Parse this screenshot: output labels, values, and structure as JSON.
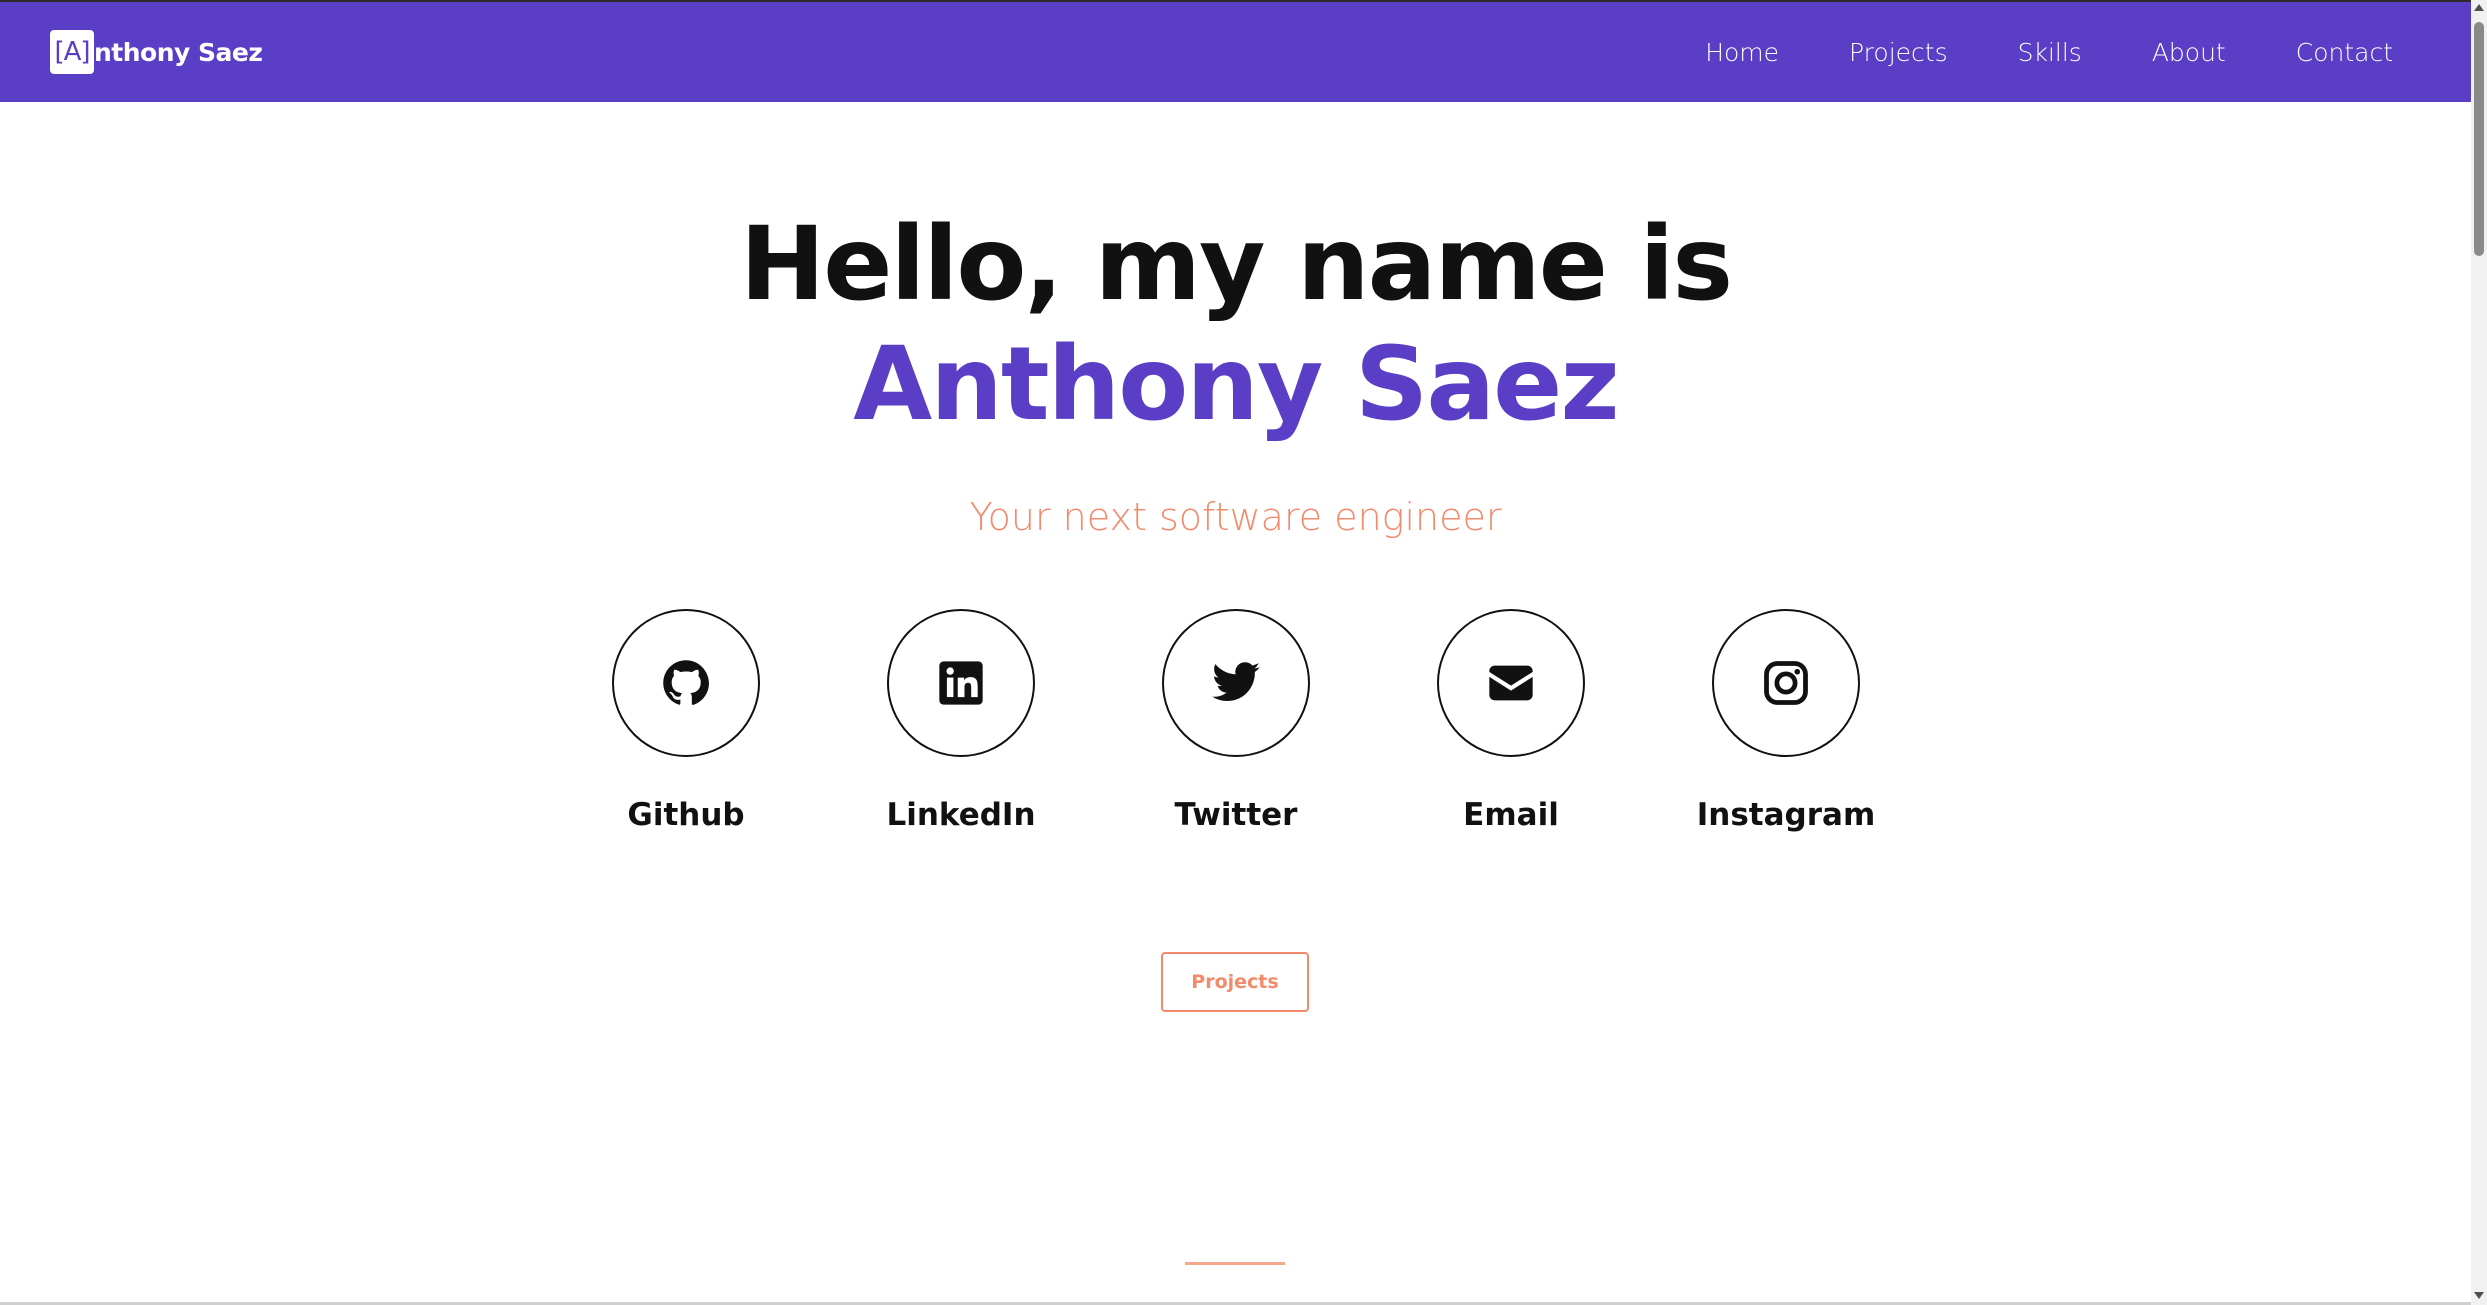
{
  "navbar": {
    "brand_box": "[A]",
    "brand_rest": "nthony Saez",
    "links": [
      "Home",
      "Projects",
      "Skills",
      "About",
      "Contact"
    ]
  },
  "hero": {
    "greeting": "Hello, my name is",
    "name": "Anthony Saez",
    "tagline": "Your next software engineer"
  },
  "socials": [
    {
      "label": "Github",
      "icon": "github-icon"
    },
    {
      "label": "LinkedIn",
      "icon": "linkedin-icon"
    },
    {
      "label": "Twitter",
      "icon": "twitter-icon"
    },
    {
      "label": "Email",
      "icon": "envelope-icon"
    },
    {
      "label": "Instagram",
      "icon": "instagram-icon"
    }
  ],
  "cta": {
    "projects_label": "Projects"
  },
  "colors": {
    "primary": "#5a3fc6",
    "accent": "#f28b6b",
    "text": "#111111"
  }
}
